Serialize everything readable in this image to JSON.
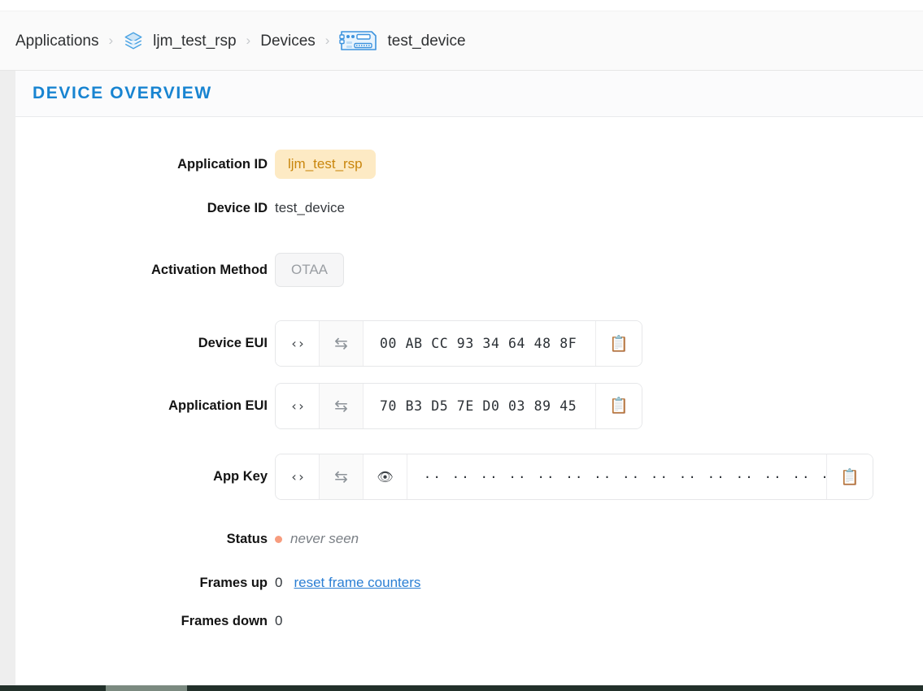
{
  "breadcrumb": {
    "items": [
      {
        "label": "Applications",
        "icon": null
      },
      {
        "label": "ljm_test_rsp",
        "icon": "layers-stack-icon"
      },
      {
        "label": "Devices",
        "icon": null
      },
      {
        "label": "test_device",
        "icon": "device-board-icon"
      }
    ],
    "separator": "›"
  },
  "panel": {
    "title": "DEVICE OVERVIEW"
  },
  "fields": {
    "application_id": {
      "label": "Application ID",
      "value": "ljm_test_rsp",
      "badge_bg": "#fdeac4",
      "badge_fg": "#c9860d"
    },
    "device_id": {
      "label": "Device ID",
      "value": "test_device"
    },
    "activation_method": {
      "label": "Activation Method",
      "value": "OTAA"
    },
    "device_eui": {
      "label": "Device EUI",
      "value": "00 AB CC 93 34 64 48 8F",
      "code_btn": "‹›",
      "swap_btn": "⇆",
      "copy_btn": "📋"
    },
    "application_eui": {
      "label": "Application EUI",
      "value": "70 B3 D5 7E D0 03 89 45",
      "code_btn": "‹›",
      "swap_btn": "⇆",
      "copy_btn": "📋"
    },
    "app_key": {
      "label": "App Key",
      "value": "·· ·· ·· ·· ·· ·· ·· ·· ·· ·· ·· ·· ·· ·· ·· ··",
      "masked": "true",
      "code_btn": "‹›",
      "swap_btn": "⇆",
      "eye_btn": "👁",
      "copy_btn": "📋"
    },
    "status": {
      "label": "Status",
      "value": "never seen",
      "dot_color": "#f79c7e"
    },
    "frames_up": {
      "label": "Frames up",
      "value": "0",
      "action_label": "reset frame counters"
    },
    "frames_down": {
      "label": "Frames down",
      "value": "0"
    }
  }
}
